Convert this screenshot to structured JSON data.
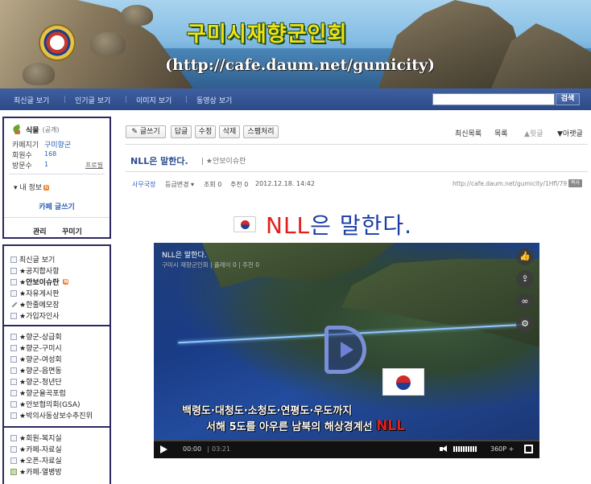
{
  "banner": {
    "title": "구미시재향군인회",
    "url": "(http://cafe.daum.net/gumicity)"
  },
  "nav": {
    "items": [
      "최신글 보기",
      "인기글 보기",
      "이미지 보기",
      "동영상 보기"
    ],
    "search_placeholder": "",
    "search_button": "검색"
  },
  "sidebar": {
    "level": "식물",
    "level_sub": "(공개)",
    "cafe_manager_label": "카페지기",
    "cafe_manager": "구미향군",
    "members_label": "회원수",
    "members": "168",
    "visitors_label": "방문수",
    "visitors": "1",
    "profile": "프로필",
    "my_info": "내 정보",
    "write": "카페 글쓰기",
    "manage": "관리",
    "decorate": "꾸미기",
    "menu_group1": [
      "최신글 보기",
      "★공지합사항",
      "★안보이슈란",
      "★자유게시판",
      "★한줄메모장",
      "★가입자인사"
    ],
    "menu_group2": [
      "★향군-상급회",
      "★향군-구미시",
      "★향군-여성회",
      "★향군-읍면동",
      "★향군-청년단",
      "★향군율곡포럼",
      "★안보협의회(GSA)",
      "★박의사동상보수추진위"
    ],
    "menu_group3": [
      "★회원-복지실",
      "★카페-자료실",
      "★오픈-자료실",
      "★카페-열병방"
    ]
  },
  "toolbar": {
    "write": "글쓰기",
    "reply": "답글",
    "edit": "수정",
    "delete": "삭제",
    "spam": "스팸처리",
    "latest": "최신목록",
    "list": "목록",
    "prev": "▲윗글",
    "next": "▼아랫글"
  },
  "post": {
    "title": "NLL은 말한다.",
    "board": "|  ★안보이슈란",
    "author": "사무국장",
    "grade": "등급변경 ▾",
    "views": "조회 0",
    "recommend": "추천 0",
    "date": "2012.12.18. 14:42",
    "url": "http://cafe.daum.net/gumicity/1Hfl/79",
    "copy": "복사",
    "headline_red": "NLL",
    "headline_blue": "은 말한다."
  },
  "video": {
    "title": "NLL은 말한다.",
    "sub": "구미시 재향군인회  |  플레이 0  |  추천 0",
    "caption1": "백령도·대청도·소청도·연평도·우도까지",
    "caption2": "서해 5도를 아우른 남북의 해상경계선 ",
    "caption2_nll": "NLL",
    "time_current": "00:00",
    "time_total": "03:21",
    "quality": "360P +",
    "side_icons": [
      "thumbs-up-icon",
      "share-icon",
      "link-icon",
      "settings-icon"
    ]
  },
  "colors": {
    "nav_bg": "#2c4a87",
    "sidebar_border": "#2b2860",
    "headline_red": "#e0201c",
    "headline_blue": "#1b3da6"
  }
}
